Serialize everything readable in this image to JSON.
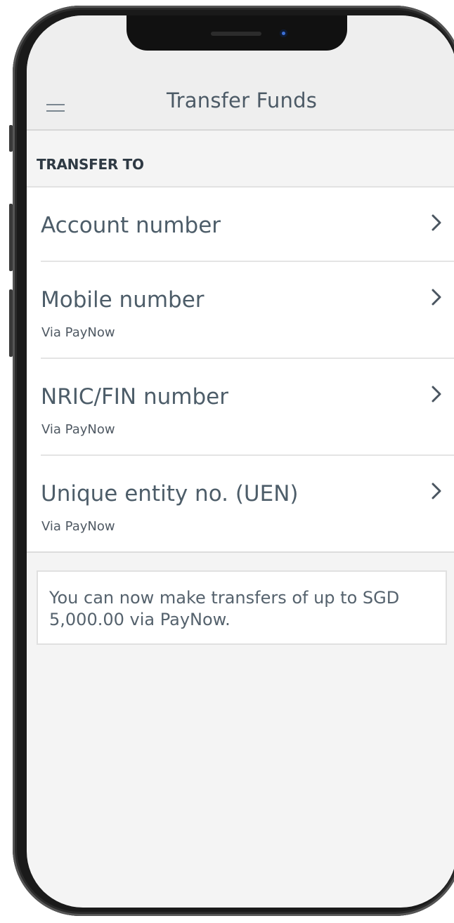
{
  "header": {
    "title": "Transfer Funds",
    "menu_icon": "hamburger-menu-icon"
  },
  "section": {
    "label": "TRANSFER TO"
  },
  "options": [
    {
      "label": "Account number",
      "sub": ""
    },
    {
      "label": "Mobile number",
      "sub": "Via PayNow"
    },
    {
      "label": "NRIC/FIN number",
      "sub": "Via PayNow"
    },
    {
      "label": "Unique entity no. (UEN)",
      "sub": "Via PayNow"
    }
  ],
  "notice": {
    "text": "You can now make transfers of up to SGD 5,000.00 via PayNow."
  },
  "colors": {
    "header_bg": "#eeeeee",
    "text_primary": "#4d5d69",
    "chevron": "#4a5560"
  }
}
